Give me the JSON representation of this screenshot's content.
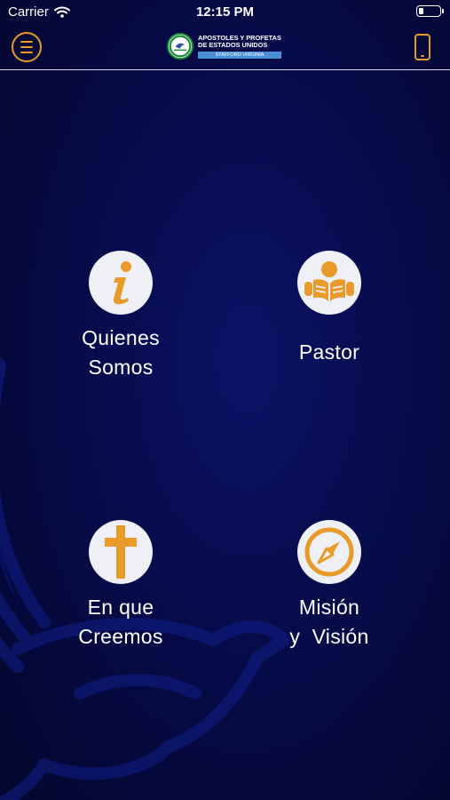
{
  "status_bar": {
    "carrier": "Carrier",
    "time": "12:15 PM",
    "battery_level": 0.25
  },
  "nav": {
    "logo_line1": "APOSTOLES Y PROFETAS",
    "logo_line2": "DE ESTADOS UNIDOS",
    "logo_sub": "STAFFORD VIRGINIA"
  },
  "menu": {
    "items": [
      {
        "line1": "Quienes",
        "line2": "Somos",
        "icon": "info-icon"
      },
      {
        "line1": "Pastor",
        "line2": "",
        "icon": "reader-icon"
      },
      {
        "line1": "En que",
        "line2": "Creemos",
        "icon": "cross-icon"
      },
      {
        "line1": "Misión",
        "line2": "y  Visión",
        "icon": "compass-icon"
      }
    ]
  },
  "colors": {
    "accent": "#e89a2a",
    "background": "#060b4a",
    "icon_bg": "#eef0f6"
  }
}
